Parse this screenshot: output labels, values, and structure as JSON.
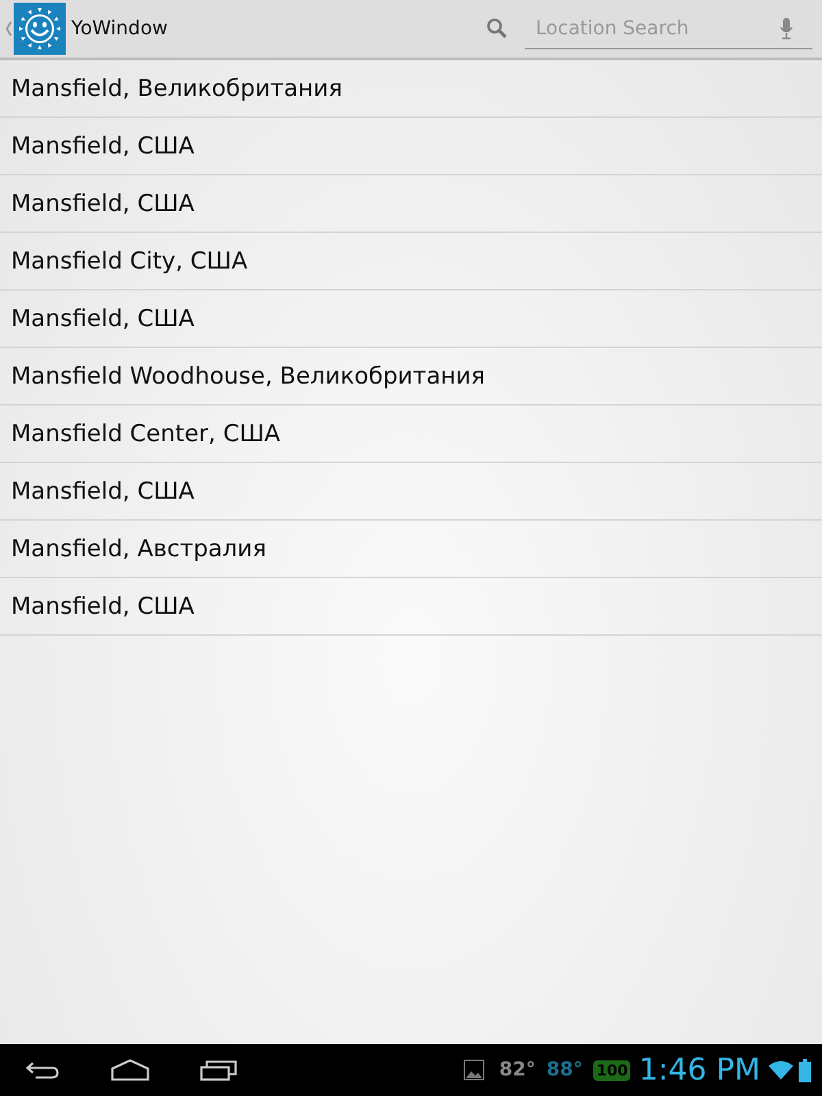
{
  "action_bar": {
    "title": "YoWindow",
    "search": {
      "placeholder": "Location Search"
    }
  },
  "results": [
    {
      "label": "Mansfield, Великобритания"
    },
    {
      "label": "Mansfield, США"
    },
    {
      "label": "Mansfield, США"
    },
    {
      "label": "Mansfield City, США"
    },
    {
      "label": "Mansfield, США"
    },
    {
      "label": "Mansfield Woodhouse, Великобритания"
    },
    {
      "label": "Mansfield Center, США"
    },
    {
      "label": "Mansfield, США"
    },
    {
      "label": "Mansfield, Австралия"
    },
    {
      "label": "Mansfield, США"
    }
  ],
  "system_bar": {
    "temp_1": "82°",
    "temp_2": "88°",
    "battery_badge": "100",
    "time": "1:46 PM"
  }
}
